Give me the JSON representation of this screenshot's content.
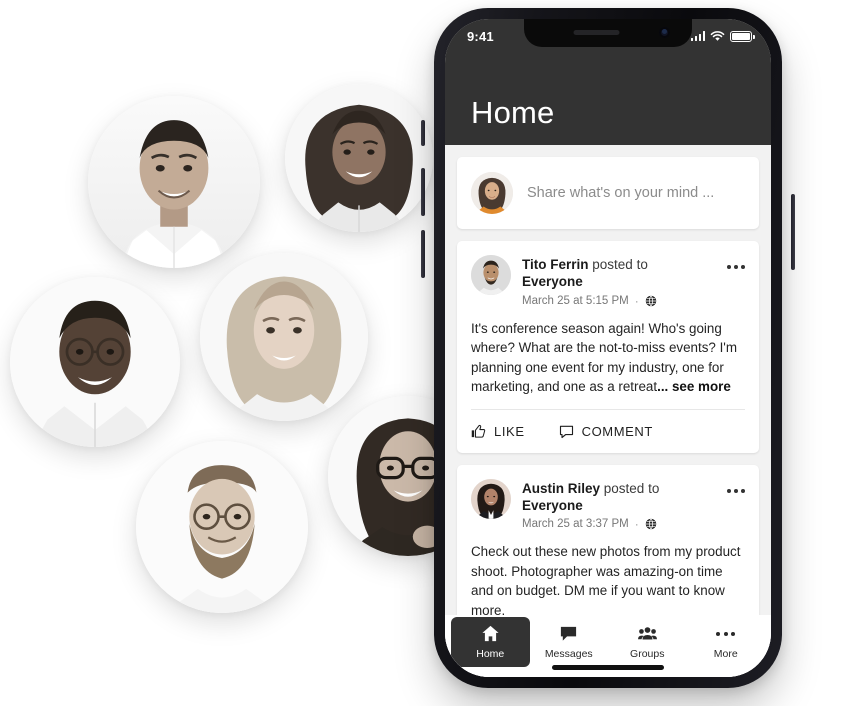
{
  "phone": {
    "status": {
      "time": "9:41",
      "signal_icon": "signal-bars-icon",
      "wifi_icon": "wifi-icon",
      "battery_icon": "battery-full-icon"
    },
    "app": {
      "title": "Home"
    },
    "composer": {
      "placeholder": "Share what's on your mind ...",
      "avatar": "avatar-current-user"
    },
    "posts": [
      {
        "author": "Tito Ferrin",
        "action": "posted to",
        "audience": "Everyone",
        "timestamp": "March 25 at 5:15 PM",
        "separator": "·",
        "privacy_icon": "globe-icon",
        "menu_icon": "kebab-menu-icon",
        "body": "It's conference season again! Who's going where? What are the not-to-miss events? I'm planning one event for my industry, one for marketing, and one as a retreat",
        "see_more": "... see more",
        "actions": [
          {
            "label": "LIKE",
            "icon": "thumbs-up-icon"
          },
          {
            "label": "COMMENT",
            "icon": "comment-bubble-icon"
          }
        ]
      },
      {
        "author": "Austin Riley",
        "action": "posted to",
        "audience": "Everyone",
        "timestamp": "March 25 at 3:37 PM",
        "separator": "·",
        "privacy_icon": "globe-icon",
        "menu_icon": "kebab-menu-icon",
        "body": "Check out these new photos from my product shoot. Photographer was amazing-on time and on budget. DM me if you want to know more."
      }
    ],
    "tabs": [
      {
        "label": "Home",
        "icon": "home-icon",
        "active": true
      },
      {
        "label": "Messages",
        "icon": "message-icon",
        "active": false
      },
      {
        "label": "Groups",
        "icon": "groups-icon",
        "active": false
      },
      {
        "label": "More",
        "icon": "more-dots-icon",
        "active": false
      }
    ]
  },
  "portraits": [
    {
      "name": "portrait-1"
    },
    {
      "name": "portrait-2"
    },
    {
      "name": "portrait-3"
    },
    {
      "name": "portrait-4"
    },
    {
      "name": "portrait-5"
    },
    {
      "name": "portrait-6"
    }
  ],
  "colors": {
    "header": "#333333",
    "feed_bg": "#f2f2f2",
    "card": "#ffffff",
    "page_bg": "#ffffff",
    "text": "#242424",
    "muted": "#777777"
  }
}
